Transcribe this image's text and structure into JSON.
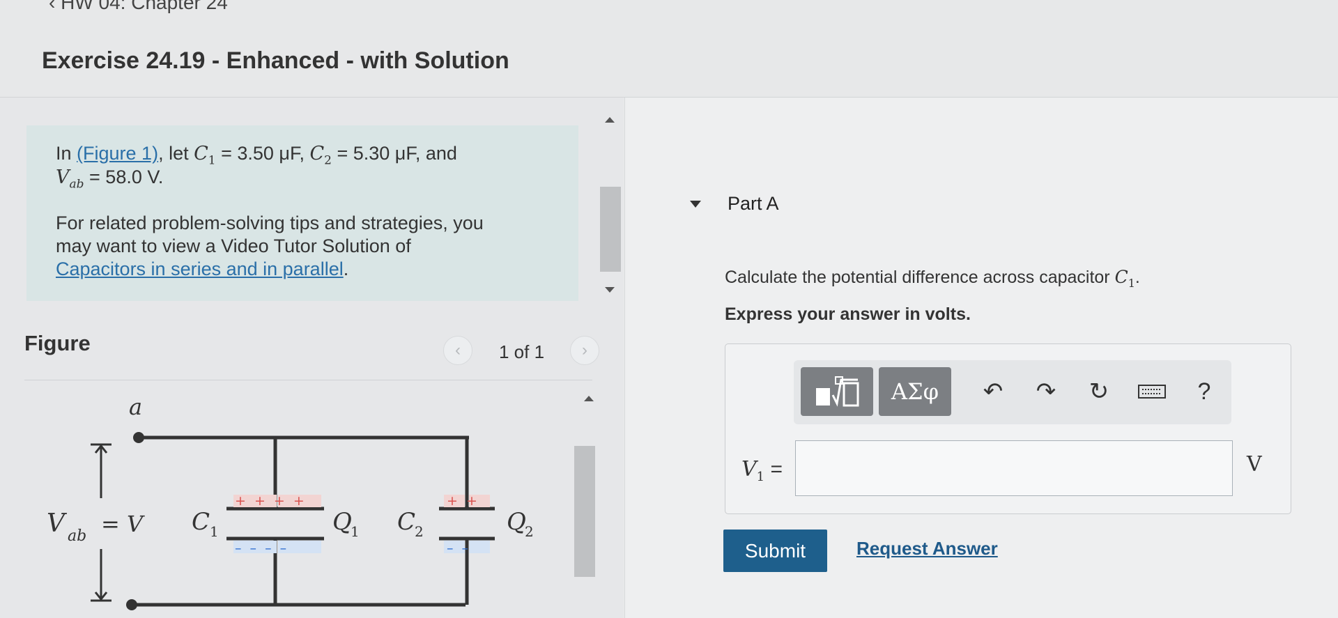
{
  "header": {
    "back_link": "HW 04: Chapter 24",
    "title": "Exercise 24.19 - Enhanced - with Solution"
  },
  "problem": {
    "line1_prefix": "In ",
    "figure_link": "(Figure 1)",
    "line1_text": ", let ",
    "c1_symbol": "C",
    "c1_sub": "1",
    "c1_value": " = 3.50 μF, ",
    "c2_symbol": "C",
    "c2_sub": "2",
    "c2_value": " = 5.30 μF, and",
    "vab_symbol": "V",
    "vab_sub": "ab",
    "vab_value": " = 58.0 V.",
    "tip_line1": "For related problem-solving tips and strategies, you",
    "tip_line2": "may want to view a Video Tutor Solution of",
    "tip_link": "Capacitors in series and in parallel",
    "tip_end": "."
  },
  "figure": {
    "label": "Figure",
    "pager_text": "1 of 1",
    "prev_icon": "chevron-left-icon",
    "next_icon": "chevron-right-icon",
    "circuit": {
      "node_a": "a",
      "vab_label": "Vab",
      "vab_sub": "ab",
      "equals_v": "= V",
      "c1_label": "C",
      "c1_sub": "1",
      "q1_label": "Q",
      "q1_sub": "1",
      "c2_label": "C",
      "c2_sub": "2",
      "q2_label": "Q",
      "q2_sub": "2",
      "c1_plus": "+ + + +",
      "c1_minus": "– – – –",
      "c2_plus": "+ +",
      "c2_minus": "– –"
    }
  },
  "part": {
    "title": "Part A",
    "question_prefix": "Calculate the potential difference across capacitor ",
    "question_symbol": "C",
    "question_sub": "1",
    "question_end": ".",
    "instruction": "Express your answer in volts.",
    "toolbar": {
      "template_icon": "math-template-icon",
      "greek_label": "ΑΣφ",
      "undo_icon": "undo-icon",
      "redo_icon": "redo-icon",
      "reset_icon": "reset-icon",
      "keyboard_icon": "keyboard-icon",
      "help_label": "?"
    },
    "answer_label": "V",
    "answer_sub": "1",
    "answer_equals": "=",
    "answer_value": "",
    "unit": "V"
  },
  "actions": {
    "submit": "Submit",
    "request_answer": "Request Answer"
  },
  "colors": {
    "problem_bg": "#d9e5e5",
    "link": "#2a6fa8",
    "submit_bg": "#1e5f8c",
    "plus_charge": "#d9534f",
    "minus_charge": "#2f6fd1"
  }
}
